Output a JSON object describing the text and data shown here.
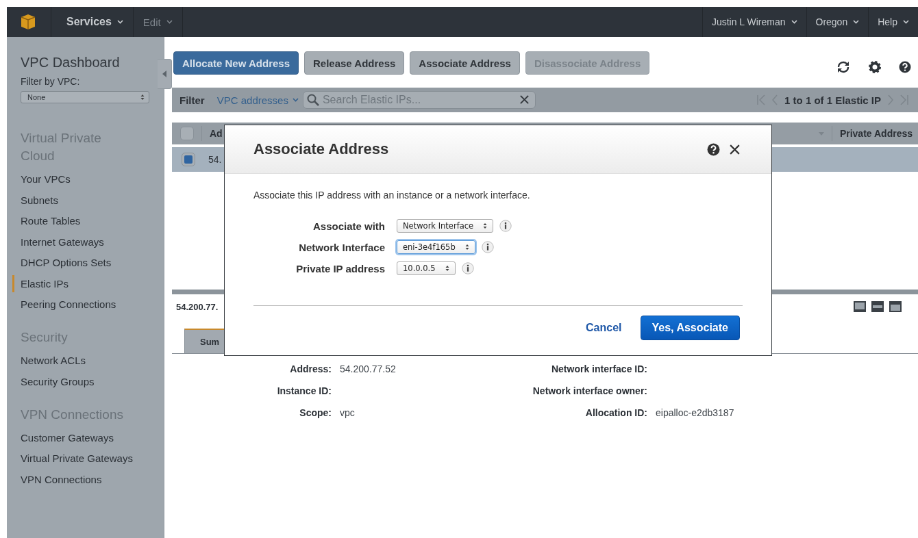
{
  "top_nav": {
    "left": [
      {
        "label": "Services",
        "disabled": false
      },
      {
        "label": "Edit",
        "disabled": true
      }
    ],
    "right": [
      "Justin L Wireman",
      "Oregon",
      "Help"
    ]
  },
  "sidebar": {
    "title": "VPC Dashboard",
    "filter_label": "Filter by VPC:",
    "filter_value": "None",
    "sections": [
      {
        "heading": "Virtual Private Cloud",
        "items": [
          {
            "label": "Your VPCs",
            "selected": false
          },
          {
            "label": "Subnets",
            "selected": false
          },
          {
            "label": "Route Tables",
            "selected": false
          },
          {
            "label": "Internet Gateways",
            "selected": false
          },
          {
            "label": "DHCP Options Sets",
            "selected": false
          },
          {
            "label": "Elastic IPs",
            "selected": true
          },
          {
            "label": "Peering Connections",
            "selected": false
          }
        ]
      },
      {
        "heading": "Security",
        "items": [
          {
            "label": "Network ACLs",
            "selected": false
          },
          {
            "label": "Security Groups",
            "selected": false
          }
        ]
      },
      {
        "heading": "VPN Connections",
        "items": [
          {
            "label": "Customer Gateways",
            "selected": false
          },
          {
            "label": "Virtual Private Gateways",
            "selected": false
          },
          {
            "label": "VPN Connections",
            "selected": false
          }
        ]
      }
    ]
  },
  "toolbar": {
    "buttons": [
      {
        "label": "Allocate New Address",
        "kind": "primary",
        "disabled": false
      },
      {
        "label": "Release Address",
        "kind": "default",
        "disabled": false
      },
      {
        "label": "Associate Address",
        "kind": "default",
        "disabled": false
      },
      {
        "label": "Disassociate Address",
        "kind": "default",
        "disabled": true
      }
    ]
  },
  "filter_bar": {
    "label": "Filter",
    "dropdown": "VPC addresses",
    "search_placeholder": "Search Elastic IPs...",
    "pagination": "1 to 1 of 1 Elastic IP"
  },
  "table": {
    "columns": [
      "Ad",
      "Private Address"
    ],
    "header_checked": false,
    "rows": [
      {
        "selected": true,
        "cells": [
          "54."
        ]
      }
    ]
  },
  "detail": {
    "title": "54.200.77.",
    "tabs": [
      {
        "label": "Sum",
        "selected": true
      }
    ],
    "fields": [
      {
        "label": "Address:",
        "value": "54.200.77.52"
      },
      {
        "label": "Network interface ID:"
      },
      {
        "label": "Instance ID:"
      },
      {
        "label": "Network interface owner:"
      },
      {
        "label": "Scope:",
        "value": "vpc"
      },
      {
        "label": "Allocation ID:",
        "value": "eipalloc-e2db3187"
      }
    ]
  },
  "dialog": {
    "title": "Associate Address",
    "description": "Associate this IP address with an instance or a network interface.",
    "fields": [
      {
        "label": "Associate with",
        "value": "Network Interface",
        "focused": false
      },
      {
        "label": "Network Interface",
        "value": "eni-3e4f165b",
        "focused": true
      },
      {
        "label": "Private IP address",
        "value": "10.0.0.5",
        "focused": false
      }
    ],
    "buttons": [
      {
        "label": "Cancel",
        "kind": "link"
      },
      {
        "label": "Yes, Associate",
        "kind": "primary"
      }
    ]
  }
}
